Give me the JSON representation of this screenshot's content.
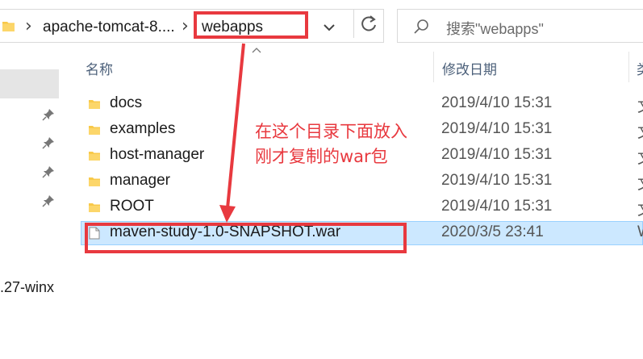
{
  "address_bar": {
    "crumbs": [
      "apache-tomcat-8....",
      "webapps"
    ]
  },
  "search": {
    "placeholder": "搜索\"webapps\""
  },
  "columns": {
    "name": "名称",
    "modified": "修改日期",
    "type_partial": "类"
  },
  "nav": {
    "truncated_item": ".27-winx"
  },
  "files": [
    {
      "name": "docs",
      "modified": "2019/4/10 15:31",
      "type": "文",
      "kind": "folder"
    },
    {
      "name": "examples",
      "modified": "2019/4/10 15:31",
      "type": "文",
      "kind": "folder"
    },
    {
      "name": "host-manager",
      "modified": "2019/4/10 15:31",
      "type": "文",
      "kind": "folder"
    },
    {
      "name": "manager",
      "modified": "2019/4/10 15:31",
      "type": "文",
      "kind": "folder"
    },
    {
      "name": "ROOT",
      "modified": "2019/4/10 15:31",
      "type": "文",
      "kind": "folder"
    },
    {
      "name": "maven-study-1.0-SNAPSHOT.war",
      "modified": "2020/3/5 23:41",
      "type": "W",
      "kind": "file",
      "selected": true
    }
  ],
  "annotation": {
    "line1": "在这个目录下面放入",
    "line2": "刚才复制的war包",
    "color": "#e8393f"
  },
  "colors": {
    "selection": "#cce8ff",
    "folder": "#f8c94a"
  }
}
